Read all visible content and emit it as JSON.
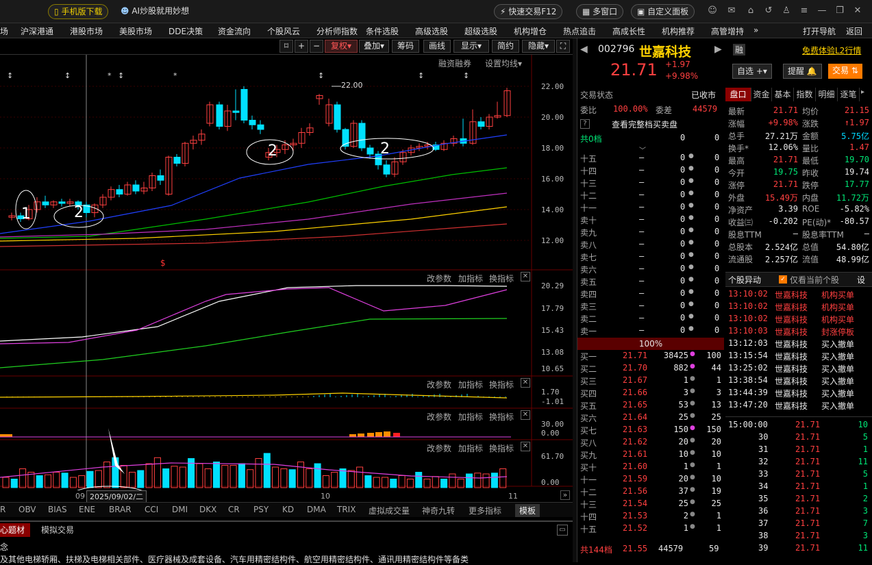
{
  "topbar": {
    "mobile_download": "手机版下载",
    "ai_promo": "AI炒股就用妙想",
    "quick_trade": "快速交易F12",
    "multi_window": "多窗口",
    "custom_panel": "自定义面板"
  },
  "menu": [
    "场",
    "沪深港通",
    "港股市场",
    "美股市场",
    "DDE决策",
    "资金流向",
    "个股风云",
    "分析师指数",
    "条件选股",
    "高级选股",
    "超级选股",
    "机构增仓",
    "热点追击",
    "高成长性",
    "机构推荐",
    "高管增持",
    "打开导航",
    "返回"
  ],
  "chart_toolbar": {
    "restore": "复权",
    "overlay": "叠加",
    "chips": "筹码",
    "draw": "画线",
    "display": "显示",
    "simple": "简约",
    "hide": "隐藏",
    "margin": "融资融券",
    "set_ma": "设置均线"
  },
  "main_chart": {
    "price_axis": [
      "22.00",
      "20.00",
      "18.00",
      "16.00",
      "14.00",
      "12.00"
    ],
    "peak_label": "22.00",
    "annotations": [
      "1",
      "2",
      "2",
      "2"
    ],
    "marker": "$"
  },
  "indicator_panels": [
    {
      "actions": [
        "改参数",
        "加指标",
        "换指标"
      ],
      "axis": [
        "20.29",
        "17.79",
        "15.43",
        "13.08",
        "10.65"
      ]
    },
    {
      "actions": [
        "改参数",
        "加指标",
        "换指标"
      ],
      "axis": [
        "1.70",
        "-1.01"
      ]
    },
    {
      "actions": [
        "改参数",
        "加指标",
        "换指标"
      ],
      "axis": [
        "30.00",
        "0.00"
      ]
    },
    {
      "actions": [
        "改参数",
        "加指标",
        "换指标"
      ],
      "axis": [
        "61.70",
        "0.00"
      ]
    }
  ],
  "time_axis": {
    "month_09": "09",
    "cursor_date": "2025/09/02/二",
    "month_10": "10",
    "month_11": "11"
  },
  "indicator_tabs": [
    "R",
    "OBV",
    "BIAS",
    "ENE",
    "BRAR",
    "CCI",
    "DMI",
    "DKX",
    "CR",
    "PSY",
    "KD",
    "DMA",
    "TRIX",
    "虚拟成交量",
    "神奇九转",
    "更多指标",
    "模板"
  ],
  "info_tabs": {
    "core": "心题材",
    "sim": "模拟交易"
  },
  "info_text": "念",
  "info_line": "及其他电梯轿厢、扶梯及电梯相关部件、医疗器械及成套设备、汽车用精密结构件、航空用精密结构件、通讯用精密结构件等备类",
  "stock": {
    "code": "002796",
    "name": "世嘉科技",
    "badge": "融",
    "price": "21.71",
    "change": "+1.97",
    "change_pct": "+9.98%",
    "l2_link": "免费体验L2行情",
    "add_fav": "自选",
    "remind": "提醒",
    "trade": "交易"
  },
  "trade_status": {
    "label": "交易状态",
    "value": "已收市",
    "weibi_label": "委比",
    "weibi": "100.00%",
    "weicha_label": "委差",
    "weicha": "44579",
    "full_queue": "查看完整档买卖盘",
    "total_label": "共0档",
    "total_a": "0",
    "total_b": "0"
  },
  "sell_levels": [
    {
      "name": "十五",
      "price": "—",
      "vol": "0",
      "cnt": "0"
    },
    {
      "name": "十四",
      "price": "—",
      "vol": "0",
      "cnt": "0"
    },
    {
      "name": "十三",
      "price": "—",
      "vol": "0",
      "cnt": "0"
    },
    {
      "name": "十二",
      "price": "—",
      "vol": "0",
      "cnt": "0"
    },
    {
      "name": "十一",
      "price": "—",
      "vol": "0",
      "cnt": "0"
    },
    {
      "name": "卖十",
      "price": "—",
      "vol": "0",
      "cnt": "0"
    },
    {
      "name": "卖九",
      "price": "—",
      "vol": "0",
      "cnt": "0"
    },
    {
      "name": "卖八",
      "price": "—",
      "vol": "0",
      "cnt": "0"
    },
    {
      "name": "卖七",
      "price": "—",
      "vol": "0",
      "cnt": "0"
    },
    {
      "name": "卖六",
      "price": "—",
      "vol": "0",
      "cnt": "0"
    },
    {
      "name": "卖五",
      "price": "—",
      "vol": "0",
      "cnt": "0"
    },
    {
      "name": "卖四",
      "price": "—",
      "vol": "0",
      "cnt": "0"
    },
    {
      "name": "卖三",
      "price": "—",
      "vol": "0",
      "cnt": "0"
    },
    {
      "name": "卖二",
      "price": "—",
      "vol": "0",
      "cnt": "0"
    },
    {
      "name": "卖一",
      "price": "—",
      "vol": "0",
      "cnt": "0"
    }
  ],
  "mid_pct": "100%",
  "buy_levels": [
    {
      "name": "买一",
      "price": "21.71",
      "vol": "38425",
      "cnt": "100"
    },
    {
      "name": "买二",
      "price": "21.70",
      "vol": "882",
      "cnt": "44"
    },
    {
      "name": "买三",
      "price": "21.67",
      "vol": "1",
      "cnt": "1"
    },
    {
      "name": "买四",
      "price": "21.66",
      "vol": "3",
      "cnt": "3"
    },
    {
      "name": "买五",
      "price": "21.65",
      "vol": "53",
      "cnt": "13"
    },
    {
      "name": "买六",
      "price": "21.64",
      "vol": "25",
      "cnt": "25"
    },
    {
      "name": "买七",
      "price": "21.63",
      "vol": "150",
      "cnt": "150"
    },
    {
      "name": "买八",
      "price": "21.62",
      "vol": "20",
      "cnt": "20"
    },
    {
      "name": "买九",
      "price": "21.61",
      "vol": "10",
      "cnt": "10"
    },
    {
      "name": "买十",
      "price": "21.60",
      "vol": "1",
      "cnt": "1"
    },
    {
      "name": "十一",
      "price": "21.59",
      "vol": "20",
      "cnt": "10"
    },
    {
      "name": "十二",
      "price": "21.56",
      "vol": "37",
      "cnt": "19"
    },
    {
      "name": "十三",
      "price": "21.54",
      "vol": "25",
      "cnt": "25"
    },
    {
      "name": "十四",
      "price": "21.53",
      "vol": "2",
      "cnt": "1"
    },
    {
      "name": "十五",
      "price": "21.52",
      "vol": "1",
      "cnt": "1"
    }
  ],
  "buy_total": {
    "label": "共144档",
    "price": "21.55",
    "vol": "44579",
    "cnt": "59"
  },
  "right_tabs": [
    "盘口",
    "资金",
    "基本",
    "指数",
    "明细",
    "逐笔"
  ],
  "quote": [
    [
      "最新",
      "21.71",
      "均价",
      "21.15"
    ],
    [
      "涨幅",
      "+9.98%",
      "涨跌",
      "↑1.97"
    ],
    [
      "总手",
      "27.21万",
      "金额",
      "5.75亿"
    ],
    [
      "换手*",
      "12.06%",
      "量比",
      "1.47"
    ],
    [
      "最高",
      "21.71",
      "最低",
      "19.70"
    ],
    [
      "今开",
      "19.75",
      "昨收",
      "19.74"
    ],
    [
      "涨停",
      "21.71",
      "跌停",
      "17.77"
    ],
    [
      "外盘",
      "15.49万",
      "内盘",
      "11.72万"
    ],
    [
      "净资产",
      "3.39",
      "ROE",
      "-5.82%"
    ],
    [
      "收益㈢",
      "-0.202",
      "PE(动)*",
      "-80.57"
    ],
    [
      "股息TTM",
      "—",
      "股息率TTM",
      "—"
    ],
    [
      "总股本",
      "2.524亿",
      "总值",
      "54.80亿"
    ],
    [
      "流通股",
      "2.257亿",
      "流值",
      "48.99亿"
    ]
  ],
  "alerts_header": {
    "title": "个股异动",
    "only_current": "仅看当前个股",
    "settings": "设"
  },
  "alerts": [
    {
      "time": "13:10:02",
      "name": "世嘉科技",
      "event": "机构买单"
    },
    {
      "time": "13:10:02",
      "name": "世嘉科技",
      "event": "机构买单"
    },
    {
      "time": "13:10:02",
      "name": "世嘉科技",
      "event": "机构买单"
    },
    {
      "time": "13:10:03",
      "name": "世嘉科技",
      "event": "封涨停板"
    },
    {
      "time": "13:12:03",
      "name": "世嘉科技",
      "event": "买入撤单"
    },
    {
      "time": "13:15:54",
      "name": "世嘉科技",
      "event": "买入撤单"
    },
    {
      "time": "13:25:02",
      "name": "世嘉科技",
      "event": "买入撤单"
    },
    {
      "time": "13:38:54",
      "name": "世嘉科技",
      "event": "买入撤单"
    },
    {
      "time": "13:44:39",
      "name": "世嘉科技",
      "event": "买入撤单"
    },
    {
      "time": "13:47:20",
      "name": "世嘉科技",
      "event": "买入撤单"
    }
  ],
  "ticks": [
    {
      "t": "15:00:00",
      "p": "21.71",
      "v": "10"
    },
    {
      "t": "30",
      "p": "21.71",
      "v": "5"
    },
    {
      "t": "31",
      "p": "21.71",
      "v": "1"
    },
    {
      "t": "32",
      "p": "21.71",
      "v": "11"
    },
    {
      "t": "33",
      "p": "21.71",
      "v": "5"
    },
    {
      "t": "34",
      "p": "21.71",
      "v": "1"
    },
    {
      "t": "35",
      "p": "21.71",
      "v": "2"
    },
    {
      "t": "36",
      "p": "21.71",
      "v": "3"
    },
    {
      "t": "37",
      "p": "21.71",
      "v": "7"
    },
    {
      "t": "38",
      "p": "21.71",
      "v": "3"
    },
    {
      "t": "39",
      "p": "21.71",
      "v": "11"
    }
  ],
  "colors": {
    "up": "#ff4040",
    "down": "#00e0ff",
    "ma5": "#ffffff",
    "ma10": "#ffd200",
    "ma20": "#e040e0",
    "ma30": "#00c000",
    "ma60": "#2040ff"
  }
}
